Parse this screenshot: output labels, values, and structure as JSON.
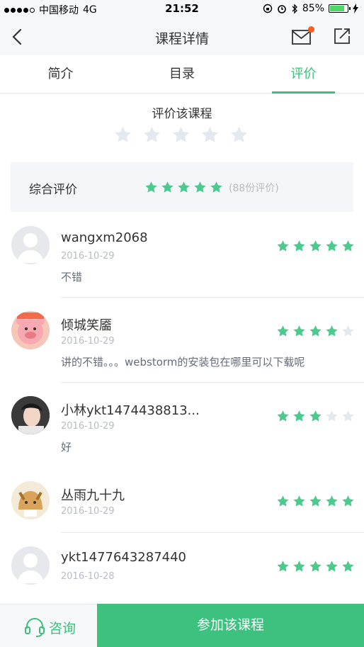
{
  "status_bar": {
    "carrier": "中国移动",
    "network": "4G",
    "time": "21:52",
    "battery_text": "85%",
    "battery_level": 0.85
  },
  "nav": {
    "title": "课程详情",
    "accent": "#3cbf7a",
    "badge_color": "#ff5a1f"
  },
  "tabs": [
    {
      "label": "简介",
      "active": false
    },
    {
      "label": "目录",
      "active": false
    },
    {
      "label": "评价",
      "active": true
    }
  ],
  "rate": {
    "title": "评价该课程",
    "stars": 0,
    "max": 5
  },
  "summary": {
    "label": "综合评价",
    "stars": 5,
    "count_text": "(88份评价)"
  },
  "reviews": [
    {
      "name": "wangxm2068",
      "date": "2016-10-29",
      "text": "不错",
      "stars": 5,
      "avatar": "default-avatar"
    },
    {
      "name": "倾城笑靥",
      "date": "2016-10-29",
      "text": "讲的不错。。。webstorm的安装包在哪里可以下载呢",
      "stars": 4,
      "avatar": "pig-avatar"
    },
    {
      "name": "小林ykt1474438813...",
      "date": "2016-10-29",
      "text": "好",
      "stars": 3,
      "avatar": "photo-avatar"
    },
    {
      "name": "丛雨九十九",
      "date": "2016-10-29",
      "text": "",
      "stars": 5,
      "avatar": "cartoon-avatar"
    },
    {
      "name": "ykt1477643287440",
      "date": "2016-10-28",
      "text": "",
      "stars": 5,
      "avatar": "default-avatar"
    }
  ],
  "bottom": {
    "consult_label": "咨询",
    "join_label": "参加该课程"
  }
}
